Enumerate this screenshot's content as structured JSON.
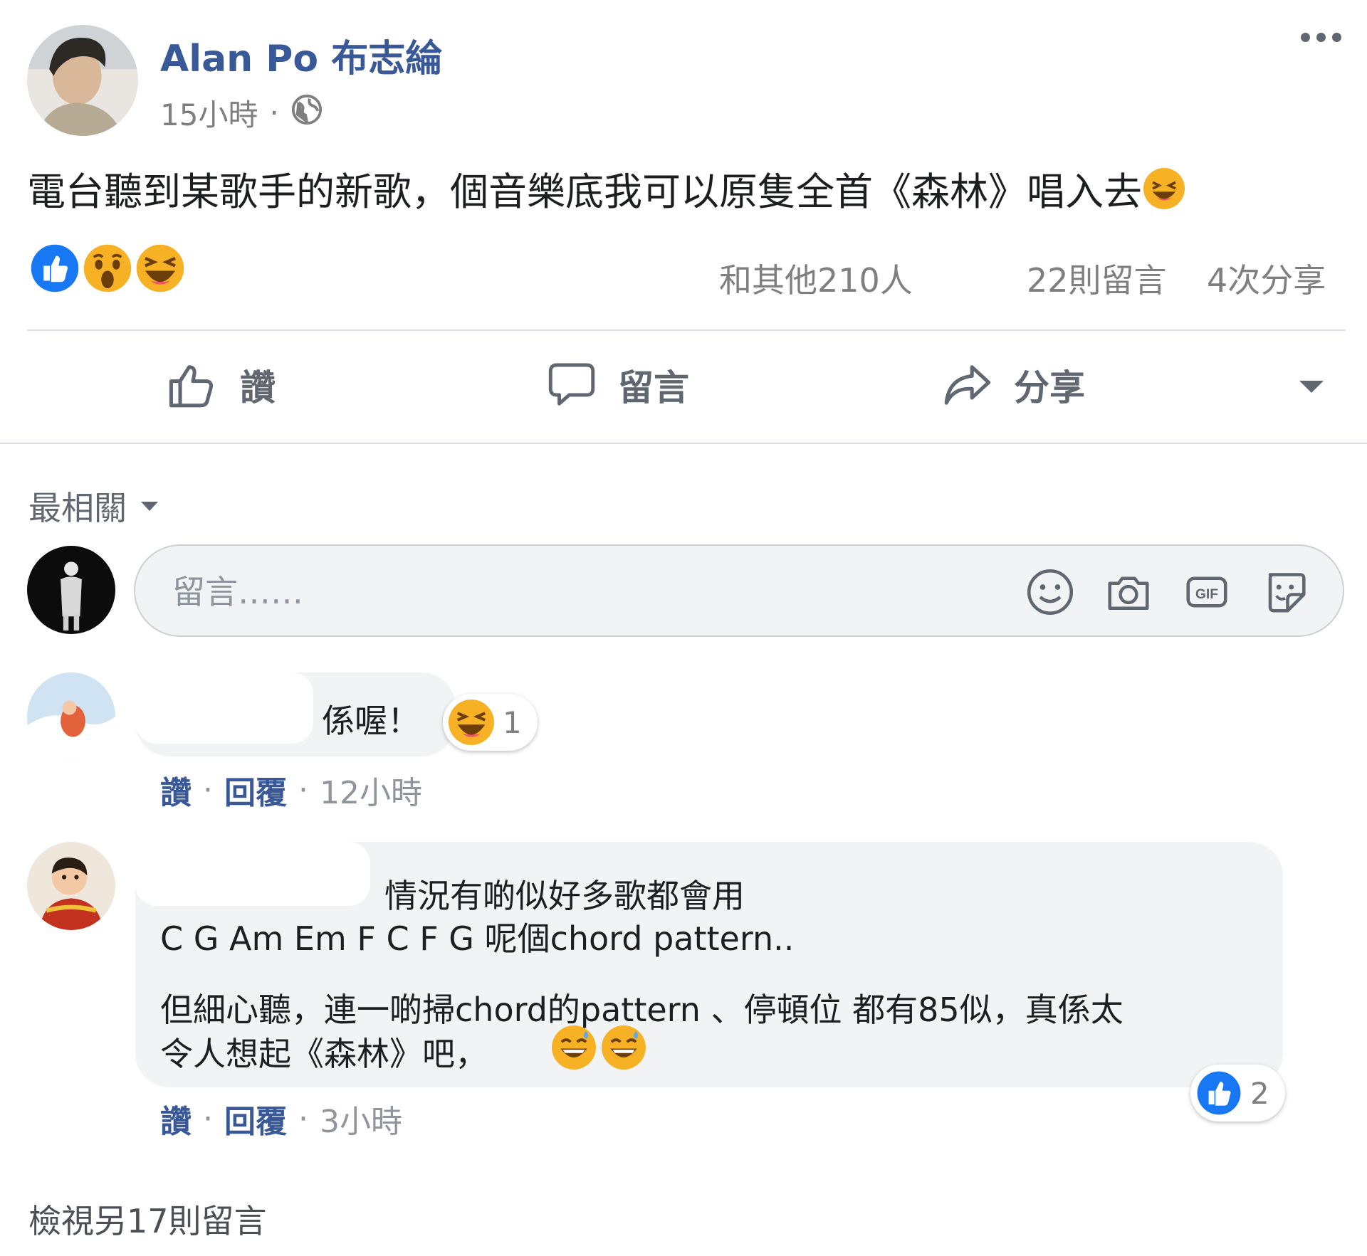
{
  "post": {
    "author": "Alan Po 布志綸",
    "time": "15小時",
    "separator": "·",
    "privacy_icon": "globe-icon",
    "text": "電台聽到某歌手的新歌，個音樂底我可以原隻全首《森林》唱入去",
    "text_emoji": "laughing-emoji",
    "more_icon": "more-options-icon"
  },
  "stats": {
    "reaction_icons": [
      "like-reaction-icon",
      "wow-reaction-icon",
      "haha-reaction-icon"
    ],
    "reactions_text": "和其他210人",
    "comments_text": "22則留言",
    "shares_text": "4次分享"
  },
  "actions": {
    "like": "讚",
    "comment": "留言",
    "share": "分享"
  },
  "sort": {
    "label": "最相關"
  },
  "composer": {
    "placeholder": "留言……",
    "icons": [
      "emoji-icon",
      "camera-icon",
      "gif-icon",
      "sticker-icon"
    ]
  },
  "comments": [
    {
      "text": "係喔！",
      "reaction": {
        "icon": "haha-reaction-icon",
        "count": "1"
      },
      "like": "讚",
      "separator": "·",
      "reply": "回覆",
      "time": "12小時"
    },
    {
      "line1": "情況有啲似好多歌都會用",
      "line2": "C G Am Em F C F G 呢個chord pattern..",
      "line3": "但細心聽，連一啲掃chord的pattern 、停頓位 都有85似，真係太",
      "line4": "令人想起《森林》吧，",
      "emojis": [
        "grinning-sweat-emoji",
        "grinning-sweat-emoji"
      ],
      "reaction": {
        "icon": "like-reaction-icon",
        "count": "2"
      },
      "like": "讚",
      "separator": "·",
      "reply": "回覆",
      "time": "3小時"
    }
  ],
  "view_more": "檢視另17則留言",
  "colors": {
    "link_blue": "#385898",
    "like_blue": "#1877f2",
    "emoji_yellow": "#f7b125",
    "bubble_gray": "#f2f3f5",
    "muted_text": "#7f7f7f"
  }
}
